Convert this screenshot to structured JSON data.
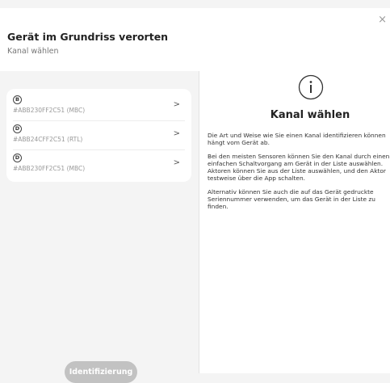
{
  "dialog": {
    "title": "Gerät im Grundriss verorten",
    "subtitle": "Kanal wählen",
    "close_glyph": "×"
  },
  "channels": [
    {
      "badge": "B",
      "serial": "#ABB230FF2C51 (MBC)"
    },
    {
      "badge": "D",
      "serial": "#ABB24CFF2C51 (RTL)"
    },
    {
      "badge": "D",
      "serial": "#ABB230FF2C51 (MBC)"
    }
  ],
  "chevron_glyph": ">",
  "identify_button": "Identifizierung",
  "info": {
    "icon": "info-circle-icon",
    "heading": "Kanal wählen",
    "paragraphs": [
      "Die Art und Weise wie Sie einen Kanal identifizieren können hängt vom Gerät ab.",
      "Bei den meisten Sensoren können Sie den Kanal durch einen einfachen Schaltvorgang am Gerät in der Liste auswählen. Aktoren können Sie aus der Liste auswählen, und den Aktor testweise über die App schalten.",
      "Alternativ können Sie auch die auf das Gerät gedruckte Seriennummer verwenden, um das Gerät in der Liste zu finden."
    ]
  }
}
